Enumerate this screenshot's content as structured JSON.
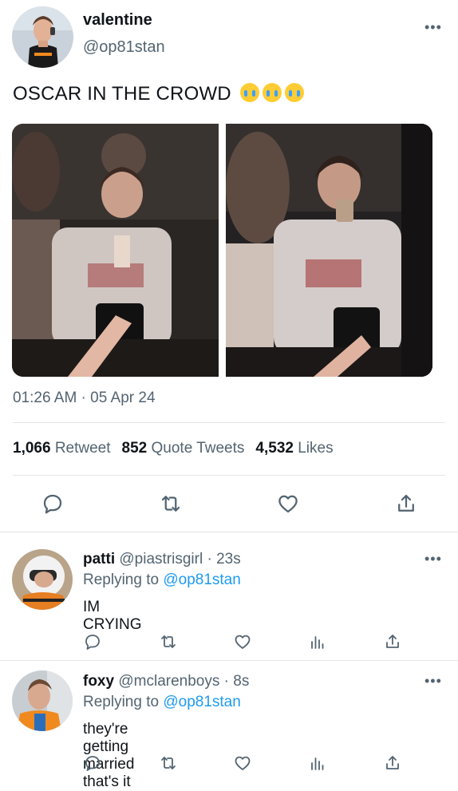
{
  "tweet": {
    "display_name": "valentine",
    "handle": "@op81stan",
    "more": "•••",
    "text": "OSCAR IN THE CROWD",
    "emoji_count": 3,
    "timestamp": "01:26 AM · 05 Apr 24",
    "stats": {
      "retweets_count": "1,066",
      "retweets_label": "Retweet",
      "quotes_count": "852",
      "quotes_label": "Quote Tweets",
      "likes_count": "4,532",
      "likes_label": "Likes"
    }
  },
  "replies": [
    {
      "display_name": "patti",
      "handle": "@piastrisgirl",
      "age": "· 23s",
      "replying_prefix": "Replying to",
      "replying_to": "@op81stan",
      "text": "IM CRYING",
      "more": "•••"
    },
    {
      "display_name": "foxy",
      "handle": "@mclarenboys",
      "age": "· 8s",
      "replying_prefix": "Replying to",
      "replying_to": "@op81stan",
      "text": "they're getting married that's it",
      "more": "•••"
    }
  ],
  "colors": {
    "text": "#0f1419",
    "secondary": "#536471",
    "link": "#1d9bf0",
    "divider": "#e3e6e8",
    "action_icon": "#536471"
  },
  "icons": {
    "reply": "comment-bubble-icon",
    "retweet": "retweet-icon",
    "like": "heart-icon",
    "share": "share-icon",
    "analytics": "analytics-bars-icon",
    "more": "more-dots-icon"
  }
}
